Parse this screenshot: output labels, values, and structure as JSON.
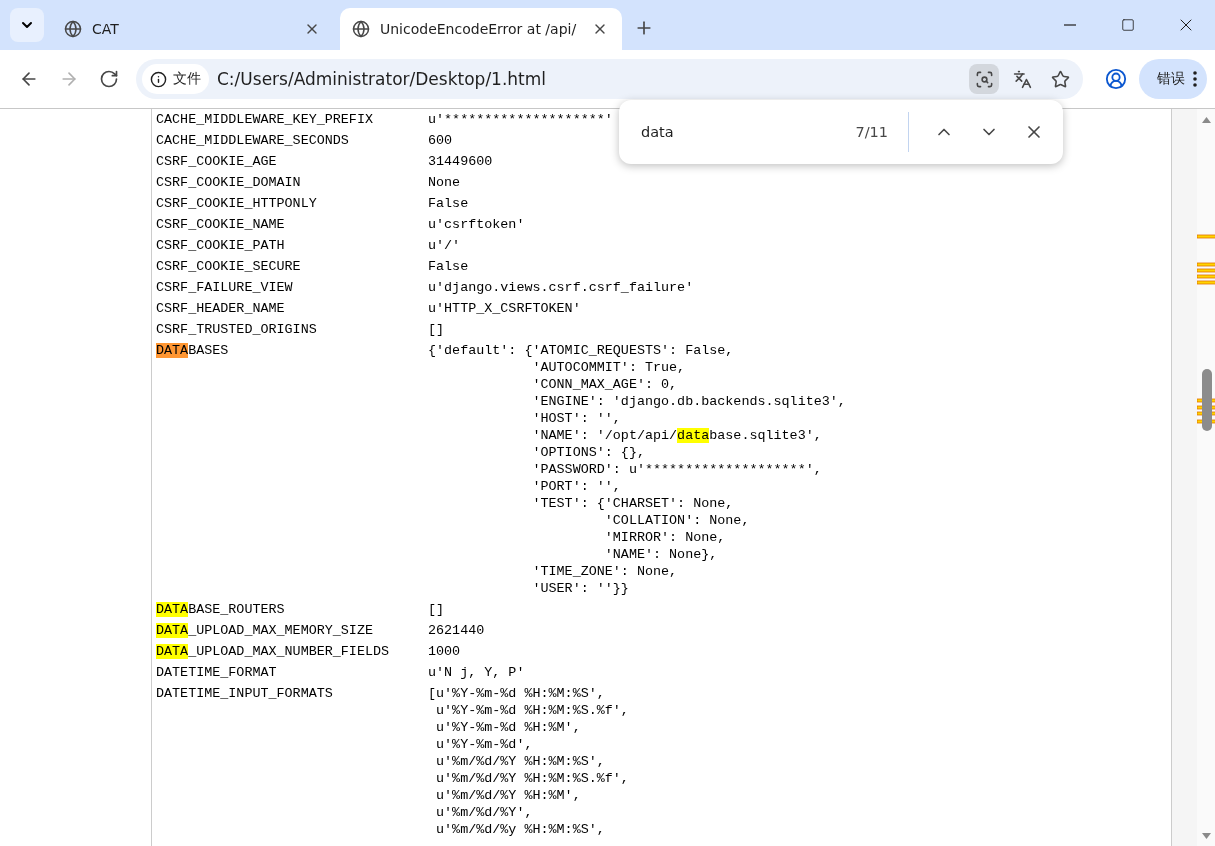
{
  "tabs": [
    {
      "title": "CAT",
      "selected": false
    },
    {
      "title": "UnicodeEncodeError at /api/",
      "selected": true
    }
  ],
  "nav_buttons": [
    {
      "kind": "back",
      "disabled": false
    },
    {
      "kind": "forward",
      "disabled": true
    },
    {
      "kind": "reload",
      "disabled": false
    }
  ],
  "address": {
    "chip": "文件",
    "url": "C:/Users/Administrator/Desktop/1.html"
  },
  "page_actions": [
    {
      "kind": "find",
      "active": true
    },
    {
      "kind": "translate",
      "active": false
    },
    {
      "kind": "bookmark",
      "active": false
    }
  ],
  "error_button": "错误",
  "find_bar": {
    "query": "data",
    "count": "7/11"
  },
  "settings": [
    {
      "key": "CACHE_MIDDLEWARE_KEY_PREFIX",
      "value": [
        "u'********************'"
      ]
    },
    {
      "key": "CACHE_MIDDLEWARE_SECONDS",
      "value": [
        "600"
      ]
    },
    {
      "key": "CSRF_COOKIE_AGE",
      "value": [
        "31449600"
      ]
    },
    {
      "key": "CSRF_COOKIE_DOMAIN",
      "value": [
        "None"
      ]
    },
    {
      "key": "CSRF_COOKIE_HTTPONLY",
      "value": [
        "False"
      ]
    },
    {
      "key": "CSRF_COOKIE_NAME",
      "value": [
        "u'csrftoken'"
      ]
    },
    {
      "key": "CSRF_COOKIE_PATH",
      "value": [
        "u'/'"
      ]
    },
    {
      "key": "CSRF_COOKIE_SECURE",
      "value": [
        "False"
      ]
    },
    {
      "key": "CSRF_FAILURE_VIEW",
      "value": [
        "u'django.views.csrf.csrf_failure'"
      ]
    },
    {
      "key": "CSRF_HEADER_NAME",
      "value": [
        "u'HTTP_X_CSRFTOKEN'"
      ]
    },
    {
      "key": "CSRF_TRUSTED_ORIGINS",
      "value": [
        "[]"
      ]
    },
    {
      "key": [
        {
          "text": "DATA",
          "highlighted": true,
          "current": true
        },
        {
          "text": "BASES",
          "highlighted": false,
          "current": false
        }
      ],
      "value": [
        "{'default': {'ATOMIC_REQUESTS': False,",
        "             'AUTOCOMMIT': True,",
        "             'CONN_MAX_AGE': 0,",
        "             'ENGINE': 'django.db.backends.sqlite3',",
        "             'HOST': '',",
        [
          {
            "text": "             'NAME': '/opt/api/",
            "highlighted": false,
            "current": false
          },
          {
            "text": "data",
            "highlighted": true,
            "current": false
          },
          {
            "text": "base.sqlite3',",
            "highlighted": false,
            "current": false
          }
        ],
        "             'OPTIONS': {},",
        "             'PASSWORD': u'********************',",
        "             'PORT': '',",
        "             'TEST': {'CHARSET': None,",
        "                      'COLLATION': None,",
        "                      'MIRROR': None,",
        "                      'NAME': None},",
        "             'TIME_ZONE': None,",
        "             'USER': ''}}"
      ]
    },
    {
      "key": [
        {
          "text": "DATA",
          "highlighted": true,
          "current": false
        },
        {
          "text": "BASE_ROUTERS",
          "highlighted": false,
          "current": false
        }
      ],
      "value": [
        "[]"
      ]
    },
    {
      "key": [
        {
          "text": "DATA",
          "highlighted": true,
          "current": false
        },
        {
          "text": "_UPLOAD_MAX_MEMORY_SIZE",
          "highlighted": false,
          "current": false
        }
      ],
      "value": [
        "2621440"
      ]
    },
    {
      "key": [
        {
          "text": "DATA",
          "highlighted": true,
          "current": false
        },
        {
          "text": "_UPLOAD_MAX_NUMBER_FIELDS",
          "highlighted": false,
          "current": false
        }
      ],
      "value": [
        "1000"
      ]
    },
    {
      "key": "DATETIME_FORMAT",
      "value": [
        "u'N j, Y, P'"
      ]
    },
    {
      "key": "DATETIME_INPUT_FORMATS",
      "value": [
        "[u'%Y-%m-%d %H:%M:%S',",
        " u'%Y-%m-%d %H:%M:%S.%f',",
        " u'%Y-%m-%d %H:%M',",
        " u'%Y-%m-%d',",
        " u'%m/%d/%Y %H:%M:%S',",
        " u'%m/%d/%Y %H:%M:%S.%f',",
        " u'%m/%d/%Y %H:%M',",
        " u'%m/%d/%Y',",
        " u'%m/%d/%y %H:%M:%S',"
      ]
    }
  ]
}
